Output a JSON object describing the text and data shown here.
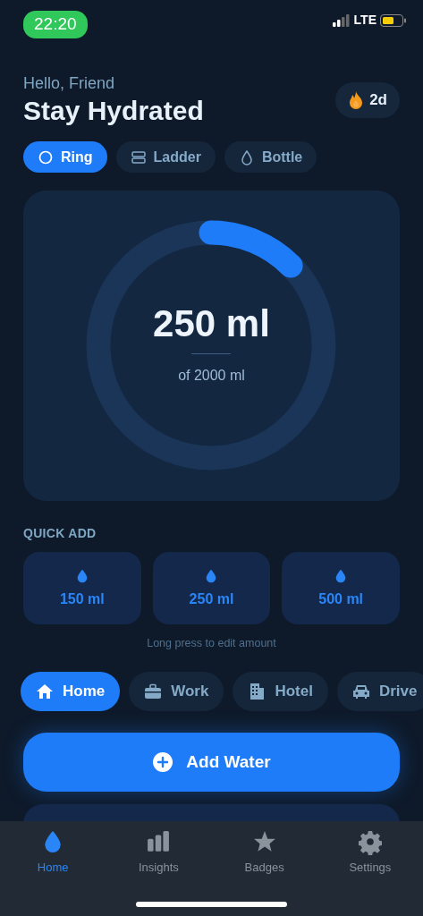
{
  "status_bar": {
    "time": "22:20",
    "network": "LTE"
  },
  "header": {
    "greeting": "Hello, Friend",
    "title": "Stay Hydrated",
    "streak": "2d"
  },
  "view_modes": [
    {
      "label": "Ring",
      "selected": true
    },
    {
      "label": "Ladder",
      "selected": false
    },
    {
      "label": "Bottle",
      "selected": false
    }
  ],
  "progress": {
    "amount": "250 ml",
    "goal": "of 2000 ml",
    "level": 0.125
  },
  "quick_add": {
    "title": "QUICK ADD",
    "amounts": [
      "150 ml",
      "250 ml",
      "500 ml"
    ],
    "hint": "Long press to edit amount"
  },
  "locations": [
    {
      "label": "Home",
      "selected": true
    },
    {
      "label": "Work",
      "selected": false
    },
    {
      "label": "Hotel",
      "selected": false
    },
    {
      "label": "Drive",
      "selected": false
    }
  ],
  "primary_button": "Add Water",
  "tabs": [
    {
      "label": "Home",
      "selected": true
    },
    {
      "label": "Insights",
      "selected": false
    },
    {
      "label": "Badges",
      "selected": false
    },
    {
      "label": "Settings",
      "selected": false
    }
  ]
}
